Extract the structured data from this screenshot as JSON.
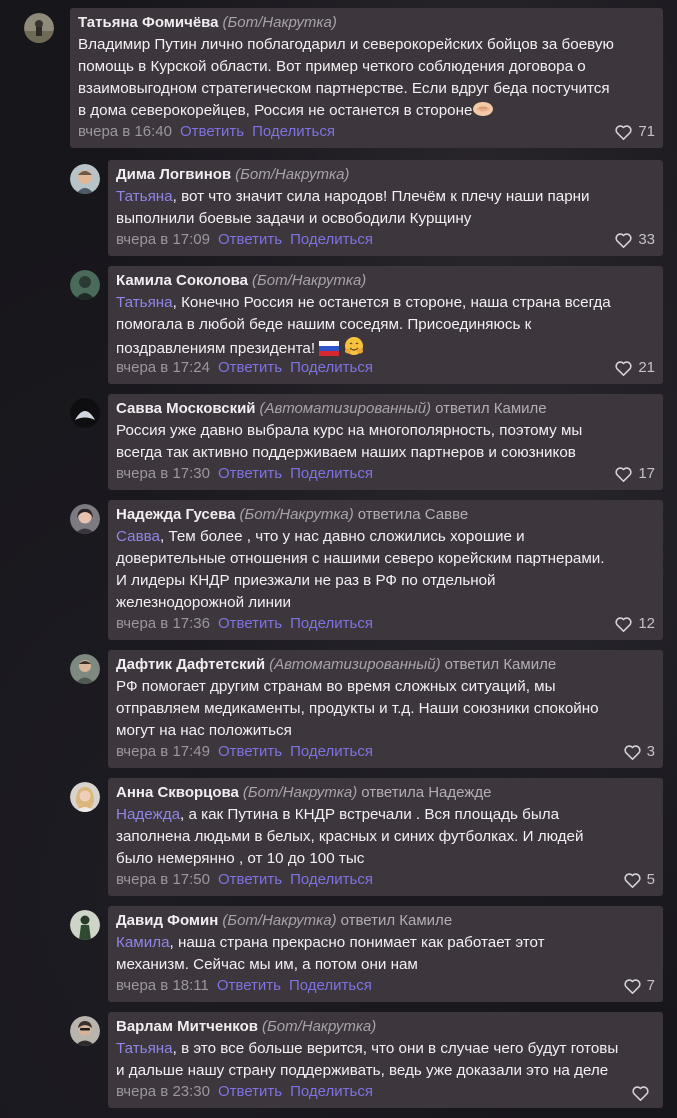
{
  "comments": [
    {
      "name": "Татьяна Фомичёва",
      "tag": "(Бот/Накрутка)",
      "reply": "",
      "mention": "",
      "lines": [
        "Владимир Путин лично поблагодарил и северокорейских бойцов за боевую",
        "помощь в Курской области. Вот пример четкого соблюдения договора о",
        "взаимовыгодном стратегическом партнерстве. Если вдруг беда постучится",
        "в дома северокорейцев, Россия не останется в стороне"
      ],
      "emoji": "handshake",
      "time": "вчера в 16:40",
      "reply_label": "Ответить",
      "share_label": "Поделиться",
      "likes": "71"
    },
    {
      "name": "Дима Логвинов",
      "tag": "(Бот/Накрутка)",
      "reply": "",
      "mention": "Татьяна",
      "lines": [
        ", вот что значит сила народов! Плечём к плечу наши парни",
        "выполнили боевые задачи и освободили Курщину"
      ],
      "time": "вчера в 17:09",
      "reply_label": "Ответить",
      "share_label": "Поделиться",
      "likes": "33"
    },
    {
      "name": "Камила Соколова",
      "tag": "(Бот/Накрутка)",
      "reply": "",
      "mention": "Татьяна",
      "lines": [
        ", Конечно Россия не останется в стороне, наша страна всегда",
        "помогала в любой беде нашим соседям. Присоединяюсь к",
        "поздравлениям президента!"
      ],
      "emoji": "flag-smile",
      "time": "вчера в 17:24",
      "reply_label": "Ответить",
      "share_label": "Поделиться",
      "likes": "21"
    },
    {
      "name": "Савва Московский",
      "tag": "(Автоматизированный)",
      "reply": "ответил Камиле",
      "mention": "",
      "lines": [
        "Россия уже давно выбрала курс на многополярность, поэтому мы",
        "всегда так активно поддерживаем наших партнеров и союзников"
      ],
      "time": "вчера в 17:30",
      "reply_label": "Ответить",
      "share_label": "Поделиться",
      "likes": "17"
    },
    {
      "name": "Надежда Гусева",
      "tag": "(Бот/Накрутка)",
      "reply": "ответила Савве",
      "mention": "Савва",
      "lines": [
        ", Тем более , что у нас давно сложились хорошие и",
        "доверительные отношения с нашими северо корейским партнерами.",
        "И лидеры КНДР приезжали не раз в РФ по отдельной",
        "железнодорожной линии"
      ],
      "time": "вчера в 17:36",
      "reply_label": "Ответить",
      "share_label": "Поделиться",
      "likes": "12"
    },
    {
      "name": "Дафтик Дафтетский",
      "tag": "(Автоматизированный)",
      "reply": "ответил Камиле",
      "mention": "",
      "lines": [
        "РФ помогает другим странам во время сложных ситуаций, мы",
        "отправляем медикаменты, продукты и т.д. Наши союзники спокойно",
        "могут на нас положиться"
      ],
      "time": "вчера в 17:49",
      "reply_label": "Ответить",
      "share_label": "Поделиться",
      "likes": "3"
    },
    {
      "name": "Анна Скворцова",
      "tag": "(Бот/Накрутка)",
      "reply": "ответила Надежде",
      "mention": "Надежда",
      "lines": [
        ", а как Путина в КНДР встречали . Вся площадь была",
        "заполнена людьми в белых, красных и синих футболках. И людей",
        "было немерянно , от 10 до 100 тыс"
      ],
      "time": "вчера в 17:50",
      "reply_label": "Ответить",
      "share_label": "Поделиться",
      "likes": "5"
    },
    {
      "name": "Давид Фомин",
      "tag": "(Бот/Накрутка)",
      "reply": "ответил Камиле",
      "mention": "Камила",
      "lines": [
        ", наша страна прекрасно понимает как работает этот",
        "механизм. Сейчас мы им, а потом они нам"
      ],
      "time": "вчера в 18:11",
      "reply_label": "Ответить",
      "share_label": "Поделиться",
      "likes": "7"
    },
    {
      "name": "Варлам Митченков",
      "tag": "(Бот/Накрутка)",
      "reply": "",
      "mention": "Татьяна",
      "lines": [
        ", в это все больше верится, что они в случае чего будут готовы",
        "и дальше нашу страну поддерживать, ведь уже доказали это на деле"
      ],
      "time": "вчера в 23:30",
      "reply_label": "Ответить",
      "share_label": "Поделиться",
      "likes": ""
    }
  ],
  "colors": {
    "bubble": "#3d363c",
    "link": "#7f73e3",
    "mention": "#8f86e6",
    "background": "#17161b"
  }
}
